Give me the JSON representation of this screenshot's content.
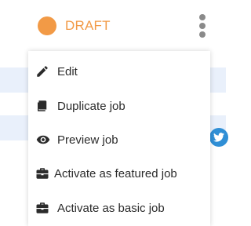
{
  "status": {
    "label": "DRAFT",
    "color": "#f29a46"
  },
  "menu": {
    "items": [
      {
        "label": "Edit",
        "icon": "pencil-icon"
      },
      {
        "label": "Duplicate job",
        "icon": "copy-icon"
      },
      {
        "label": "Preview job",
        "icon": "eye-icon"
      },
      {
        "label": "Activate as featured job",
        "icon": "briefcase-icon"
      },
      {
        "label": "Activate as basic job",
        "icon": "briefcase-icon"
      }
    ]
  },
  "colors": {
    "accent": "#f29a46",
    "text": "#2b2b2b",
    "twitter": "#2f8fd6"
  }
}
